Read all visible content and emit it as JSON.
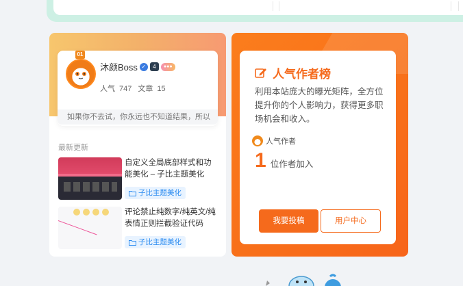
{
  "profile": {
    "username": "沐颜Boss",
    "popularity_label": "人气",
    "popularity_value": "747",
    "articles_label": "文章",
    "articles_value": "15",
    "motto": "如果你不去试，你永远也不知道结果，所以",
    "level_badge": "4",
    "crown_label": "01"
  },
  "recent": {
    "title": "最新更新",
    "posts": [
      {
        "title": "自定义全局底部样式和功能美化 – 子比主题美化",
        "tag": "子比主题美化"
      },
      {
        "title": "评论禁止纯数字/纯英文/纯表情正则拦截验证代码",
        "tag": "子比主题美化"
      }
    ]
  },
  "author_panel": {
    "heading": "人气作者榜",
    "description": "利用本站庞大的曝光矩阵，全方位提升你的个人影响力，获得更多职场机会和收入。",
    "author_label": "人气作者",
    "count": "1",
    "count_label": "位作者加入",
    "submit_button": "我要投稿",
    "user_center_button": "用户中心"
  },
  "colors": {
    "accent_orange": "#f56a1c",
    "tag_blue": "#2a8bf0",
    "top_strip": "#cdf0e4"
  },
  "icons": {
    "verified": "check-circle-icon",
    "heading": "edit-icon",
    "tag": "folder-icon"
  }
}
